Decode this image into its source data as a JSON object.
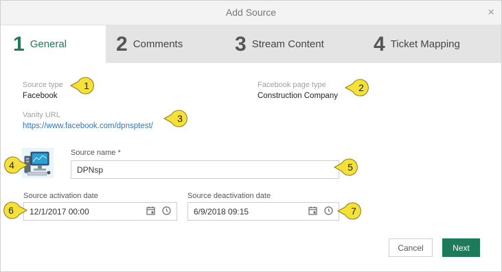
{
  "dialog": {
    "title": "Add Source",
    "close_glyph": "×"
  },
  "tabs": [
    {
      "num": "1",
      "label": "General",
      "active": true
    },
    {
      "num": "2",
      "label": "Comments",
      "active": false
    },
    {
      "num": "3",
      "label": "Stream Content",
      "active": false
    },
    {
      "num": "4",
      "label": "Ticket Mapping",
      "active": false
    }
  ],
  "fields": {
    "source_type": {
      "label": "Source type",
      "value": "Facebook"
    },
    "page_type": {
      "label": "Facebook page type",
      "value": "Construction Company"
    },
    "vanity_url": {
      "label": "Vanity URL",
      "value": "https://www.facebook.com/dpnsptest/"
    },
    "source_name": {
      "label": "Source name *",
      "value": "DPNsp"
    },
    "activation": {
      "label": "Source activation date",
      "value": "12/1/2017 00:00"
    },
    "deactivation": {
      "label": "Source deactivation date",
      "value": "6/9/2018 09:15"
    }
  },
  "callouts": [
    "1",
    "2",
    "3",
    "4",
    "5",
    "6",
    "7"
  ],
  "buttons": {
    "cancel": "Cancel",
    "next": "Next"
  },
  "colors": {
    "accent": "#1d7a5a",
    "callout": "#f6e13a",
    "link": "#2f78b7"
  },
  "icons": [
    "close-icon",
    "calendar-icon",
    "clock-icon",
    "computer-avatar-icon"
  ]
}
